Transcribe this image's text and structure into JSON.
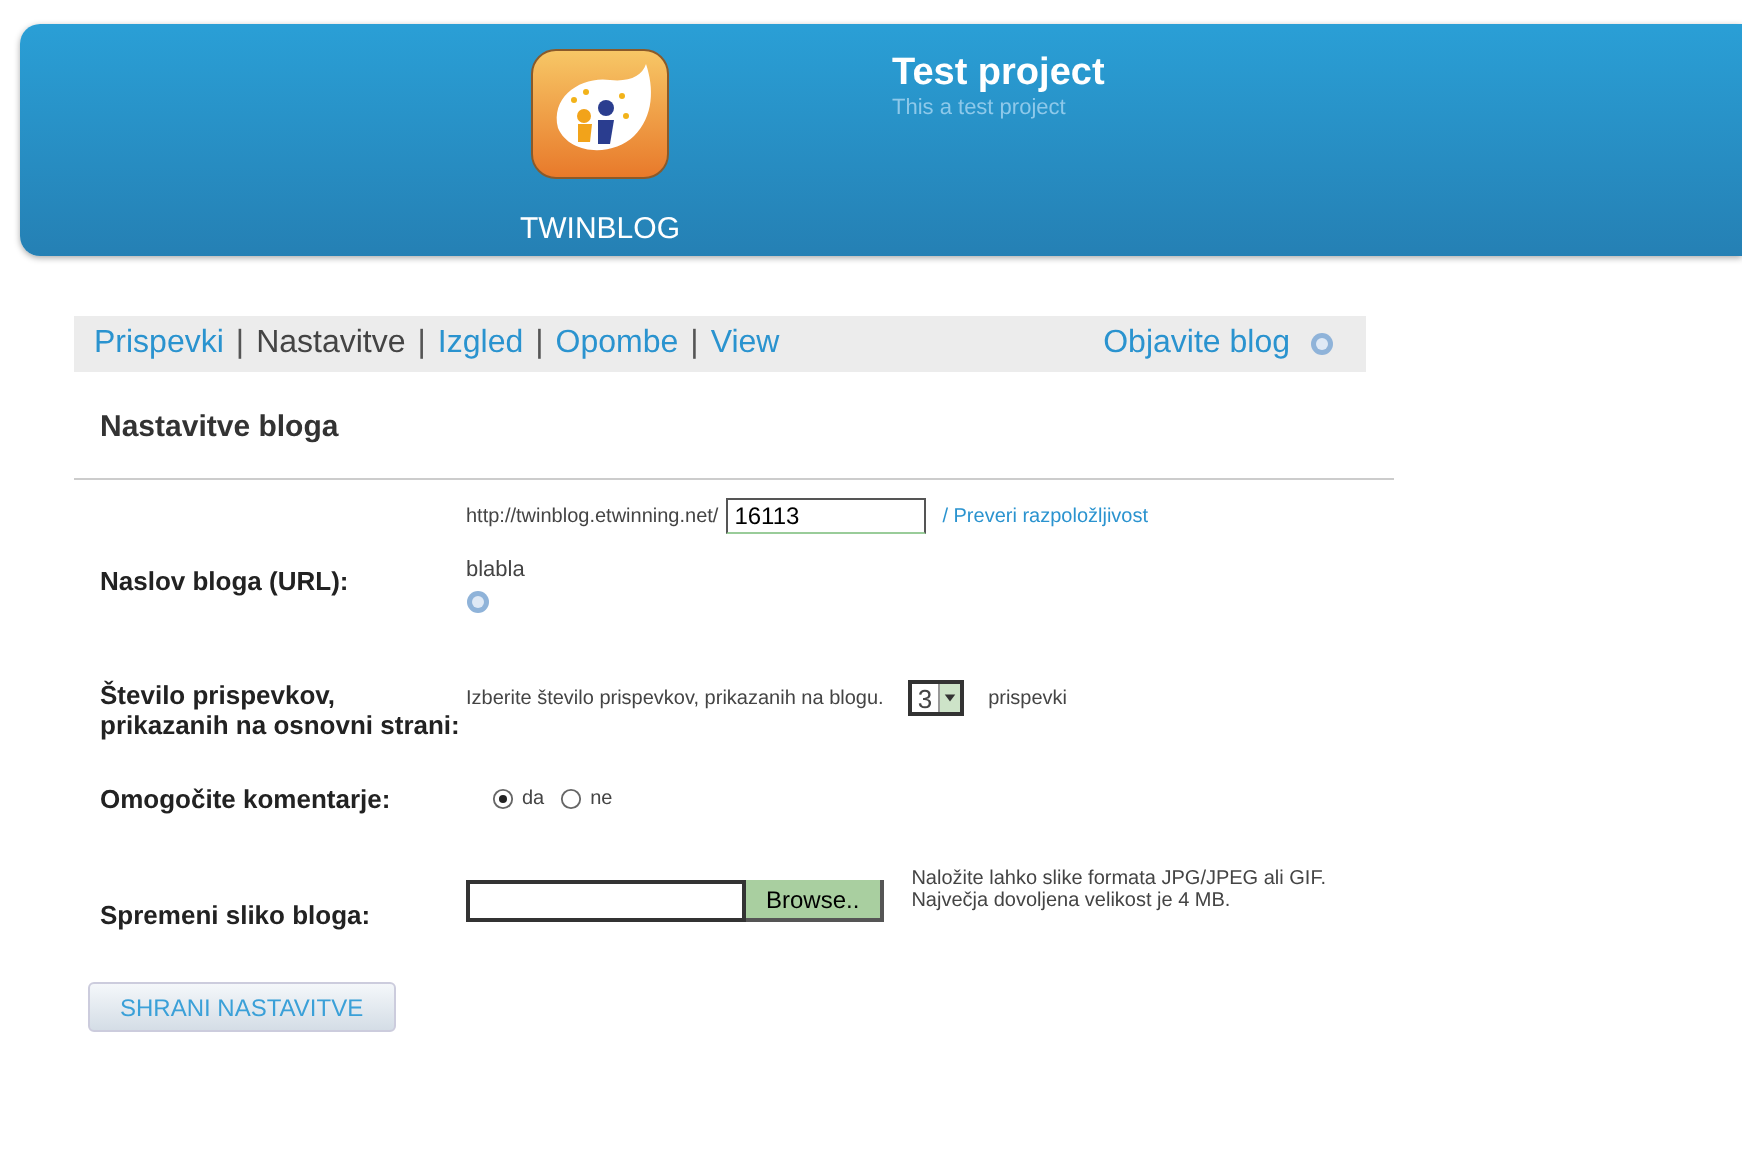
{
  "header": {
    "logo_text": "TWINBLOG",
    "title": "Test project",
    "subtitle": "This a test project"
  },
  "nav": {
    "tabs": [
      {
        "label": "Prispevki",
        "selected": false
      },
      {
        "label": "Nastavitve",
        "selected": true
      },
      {
        "label": "Izgled",
        "selected": false
      },
      {
        "label": "Opombe",
        "selected": false
      },
      {
        "label": "View",
        "selected": false
      }
    ],
    "separator": "|",
    "publish": "Objavite blog"
  },
  "heading": "Nastavitve bloga",
  "fields": [
    {
      "kind": "url",
      "label": "Naslov bloga (URL):",
      "prefix": "http://twinblog.etwinning.net/",
      "value": "16113",
      "link": "/ Preveri razpoložljivost",
      "note": "blabla"
    },
    {
      "kind": "select",
      "label": "Število prispevkov, prikazanih na osnovni strani:",
      "hint": "Izberite število prispevkov, prikazanih na blogu.",
      "value": "3",
      "suffix": "prispevki"
    },
    {
      "kind": "radio",
      "label": "Omogočite komentarje:",
      "options": [
        {
          "label": "da",
          "selected": true
        },
        {
          "label": "ne",
          "selected": false
        }
      ]
    },
    {
      "kind": "file",
      "label": "Spremeni sliko bloga:",
      "button": "Browse..",
      "notes": [
        "Naložite lahko slike formata JPG/JPEG ali GIF.",
        "Največja dovoljena velikost je 4 MB."
      ]
    }
  ],
  "save": "SHRANI NASTAVITVE"
}
